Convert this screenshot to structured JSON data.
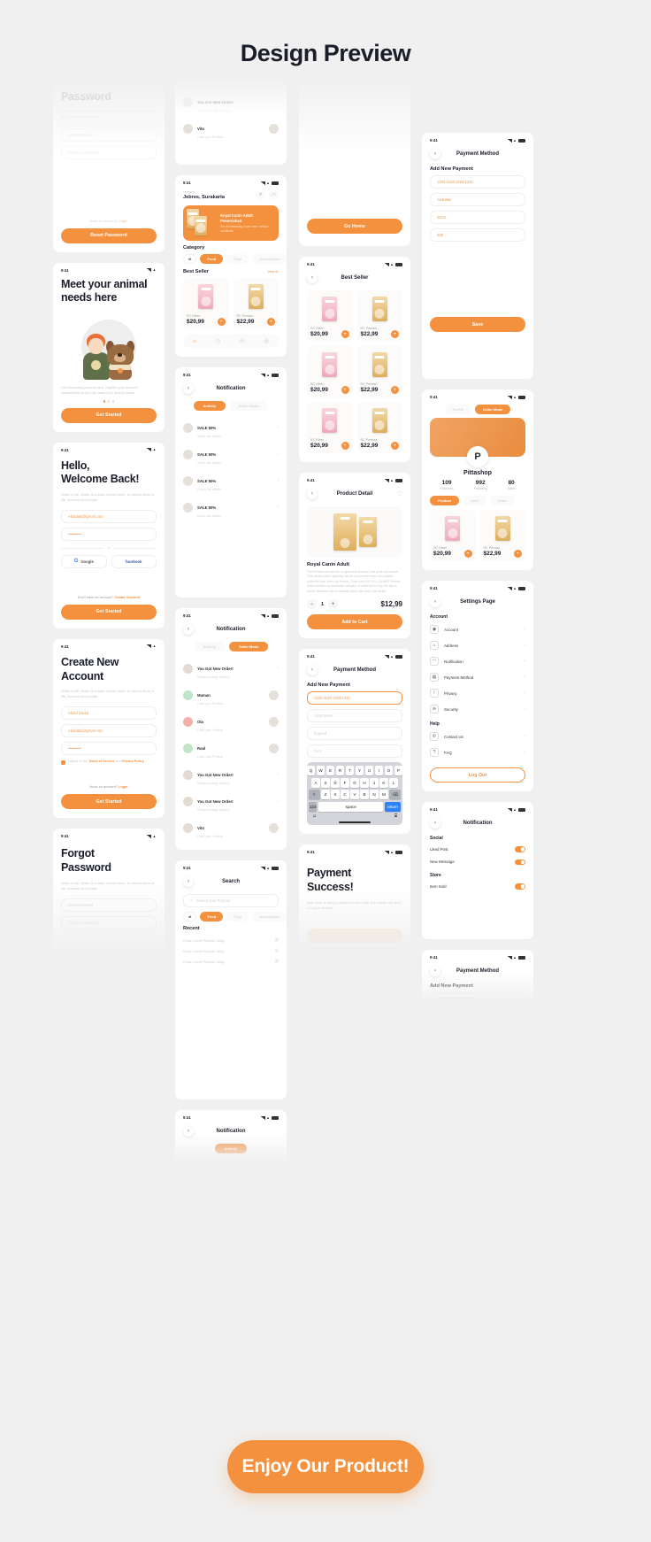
{
  "header": {
    "title": "Design Preview"
  },
  "cta": {
    "label": "Enjoy Our Product!"
  },
  "status": {
    "time": "9:41"
  },
  "common": {
    "lorem": "Water is life, Water is a basic human need. In various lines of life, humans need water.",
    "back_icon": "chevron-left-icon",
    "see_all": "View All"
  },
  "screens": {
    "reset_password": {
      "title": "Password",
      "desc": "Water is life, Water is a basic human need. In various lines of life, humans need water.",
      "fields": [
        {
          "placeholder": "New Password"
        },
        {
          "placeholder": "Confirm Password"
        }
      ],
      "note": "Have an account?",
      "note_link": "Login",
      "button": "Reset Password"
    },
    "onboarding": {
      "title": "Meet your animal needs here",
      "desc": "Get interesting promos here, register your account immediately so you can meet your animal needs.",
      "button": "Get Started"
    },
    "login": {
      "title_line1": "Hello,",
      "title_line2": "Welcome Back!",
      "desc": "Water is life, Water is a basic human need. In various lines of life, humans need water.",
      "email": "Abdulalu@gmail.com",
      "password": "••••••••••",
      "divider": "or",
      "social": [
        {
          "label": "Google",
          "icon": "google-icon"
        },
        {
          "label": "facebook",
          "icon": "facebook-icon"
        }
      ],
      "note": "Don't have an account?",
      "note_link": "Create Account",
      "button": "Get Started"
    },
    "register": {
      "title_line1": "Create New",
      "title_line2": "Account",
      "desc": "Water is life, Water is a basic human need. In various lines of life, humans need water.",
      "name": "Abdul Dudul",
      "email": "Abduldul@gmail.com",
      "password": "••••••••••",
      "agree_prefix": "I Agree to the",
      "agree_terms": "Terms of Service",
      "agree_and": "and",
      "agree_privacy": "Privacy Policy",
      "note": "Have an account?",
      "note_link": "Login",
      "button": "Get Started"
    },
    "forgot_password": {
      "title_line1": "Forgot",
      "title_line2": "Password",
      "desc": "Water is life, Water is a basic human need. In various lines of life, humans need water.",
      "fields": [
        {
          "placeholder": "New Password"
        },
        {
          "placeholder": "Confirm Password"
        }
      ]
    },
    "home": {
      "location_label": "Location",
      "location_value": "Jebres, Surakarta",
      "search_icon": "search-icon",
      "bell_icon": "bell-icon",
      "banner_title": "Royal Canin Adult Pemeriahan",
      "banner_sub": "Get an interesting promo here, without conditions",
      "category_title": "Category",
      "filter_icon": "filter-icon",
      "categories": [
        {
          "label": "Food",
          "active": true
        },
        {
          "label": "Toys",
          "active": false
        },
        {
          "label": "Accessories",
          "active": false
        }
      ],
      "best_seller_title": "Best Seller",
      "see_all": "View All",
      "products": [
        {
          "name": "RC Kitten",
          "price": "$20,99",
          "color": "pink"
        },
        {
          "name": "RC Persian",
          "price": "$22,99",
          "color": "gold"
        }
      ],
      "tabs": [
        {
          "icon": "home-icon",
          "active": true
        },
        {
          "icon": "history-icon",
          "active": false
        },
        {
          "icon": "bag-icon",
          "active": false
        },
        {
          "icon": "user-icon",
          "active": false
        }
      ]
    },
    "notification_activity": {
      "title": "Notification",
      "tabs": [
        {
          "label": "Activity",
          "active": true
        },
        {
          "label": "Seller Mode",
          "active": false
        }
      ],
      "items": [
        {
          "title": "SALE 50%",
          "sub": "Check the details"
        },
        {
          "title": "SALE 50%",
          "sub": "Check the details"
        },
        {
          "title": "SALE 50%",
          "sub": "Check the details"
        },
        {
          "title": "SALE 50%",
          "sub": "Check the details"
        }
      ]
    },
    "notification_seller": {
      "title": "Notification",
      "tabs": [
        {
          "label": "Activity",
          "active": false
        },
        {
          "label": "Seller Mode",
          "active": true
        }
      ],
      "items": [
        {
          "title": "You Got New Order!",
          "sub": "Please arrange delivery",
          "color": "#e3dbd2"
        },
        {
          "title": "Maman",
          "sub": "Liked your Product",
          "color": "#bfe6c8"
        },
        {
          "title": "Ola",
          "sub": "Liked your Product",
          "color": "#f3b0ab"
        },
        {
          "title": "Raul",
          "sub": "Liked your Product",
          "color": "#bfe6c8"
        },
        {
          "title": "You Got New Order!",
          "sub": "Please arrange delivery",
          "color": "#e3dbd2"
        },
        {
          "title": "You Got New Order!",
          "sub": "Please arrange delivery",
          "color": "#e3dbd2"
        },
        {
          "title": "Vito",
          "sub": "Liked your Product",
          "color": "#e6dcd4"
        }
      ]
    },
    "search": {
      "title": "Search",
      "placeholder": "Search your Product",
      "search_icon": "search-icon",
      "filter_icon": "filter-icon",
      "categories": [
        {
          "label": "Food",
          "active": true
        },
        {
          "label": "Toys",
          "active": false
        },
        {
          "label": "Accessories",
          "active": false
        }
      ],
      "recent_title": "Recent",
      "recent": [
        "Royal Canin Persian 500g",
        "Royal Canin Persian 500g",
        "Royal Canin Persian 500g"
      ]
    },
    "go_home": {
      "button": "Go Home"
    },
    "best_seller": {
      "title": "Best Seller",
      "products": [
        {
          "name": "RC Kitten",
          "price": "$20,99",
          "color": "pink"
        },
        {
          "name": "RC Persian",
          "price": "$22,99",
          "color": "gold"
        },
        {
          "name": "RC Kitten",
          "price": "$20,99",
          "color": "pink"
        },
        {
          "name": "RC Persian",
          "price": "$22,99",
          "color": "gold"
        },
        {
          "name": "RC Kitten",
          "price": "$20,99",
          "color": "pink"
        },
        {
          "name": "RC Persian",
          "price": "$22,99",
          "color": "gold"
        }
      ]
    },
    "product_detail": {
      "title": "Product Detail",
      "heart_icon": "heart-icon",
      "product_name": "Royal Canin Adult",
      "description": "The Persian cat has the longest and densest coat of all cat breeds. This means that it typically needs to consume more skin-health nutrients than other cat breeds. That's why ROYAL CANIN® Persian Adult contains an exclusive complex of nutrients to help the skin's barrier defense role to maintain good skin and coat health.",
      "qty": "1",
      "price": "$12,99",
      "button": "Add to Cart"
    },
    "payment_method_form": {
      "title": "Payment Method",
      "section": "Add New Payment",
      "card_number": "1233 4128 1293 1231",
      "fields": [
        {
          "placeholder": "Card Name"
        },
        {
          "placeholder": "Expired"
        },
        {
          "placeholder": "CVV"
        }
      ]
    },
    "keyboard": {
      "row1": [
        "Q",
        "W",
        "E",
        "R",
        "T",
        "Y",
        "U",
        "I",
        "O",
        "P"
      ],
      "row2": [
        "A",
        "S",
        "D",
        "F",
        "G",
        "H",
        "J",
        "K",
        "L"
      ],
      "row3": [
        "Z",
        "X",
        "C",
        "V",
        "B",
        "N",
        "M"
      ],
      "shift": "shift-icon",
      "backspace": "backspace-icon",
      "numbers": "123",
      "space": "space",
      "return": "return",
      "emoji": "emoji-icon",
      "mic": "mic-icon"
    },
    "payment_success": {
      "title_line1": "Payment",
      "title_line2": "Success!",
      "desc": "your order is being prepared by the shop, the courier will send it to your address"
    },
    "payment_method_saved": {
      "title": "Payment Method",
      "section": "Add New Payment",
      "fields": [
        {
          "value": "1233 4128 1293 1231"
        },
        {
          "value": "Abdulalu"
        },
        {
          "value": "28/12"
        },
        {
          "value": "308"
        }
      ],
      "button": "Save"
    },
    "profile": {
      "tabs": [
        {
          "label": "Profile",
          "active": false
        },
        {
          "label": "Seller Mode",
          "active": true
        }
      ],
      "avatar_letter": "P",
      "shop_name": "Pittashop",
      "stats": [
        {
          "value": "109",
          "label": "Followers"
        },
        {
          "value": "992",
          "label": "Following"
        },
        {
          "value": "80",
          "label": "Sales"
        }
      ],
      "chips": [
        {
          "label": "Product",
          "active": true
        },
        {
          "label": "Sold",
          "active": false
        },
        {
          "label": "Sales",
          "active": false
        }
      ],
      "products": [
        {
          "name": "RC Kitten",
          "price": "$20,99",
          "color": "pink"
        },
        {
          "name": "RC Persian",
          "price": "$22,99",
          "color": "gold"
        }
      ]
    },
    "settings": {
      "title": "Settings Page",
      "groups": [
        {
          "name": "Account",
          "items": [
            {
              "label": "Account",
              "icon": "user-icon"
            },
            {
              "label": "Address",
              "icon": "home-icon"
            },
            {
              "label": "Notification",
              "icon": "bell-icon"
            },
            {
              "label": "Payment Method",
              "icon": "card-icon"
            },
            {
              "label": "Privacy",
              "icon": "info-icon"
            },
            {
              "label": "Security",
              "icon": "shield-icon"
            }
          ]
        },
        {
          "name": "Help",
          "items": [
            {
              "label": "Contact Us",
              "icon": "phone-icon"
            },
            {
              "label": "FAQ",
              "icon": "question-icon"
            }
          ]
        }
      ],
      "logout": "Log Out"
    },
    "notification_settings": {
      "title": "Notification",
      "groups": [
        {
          "name": "Social",
          "items": [
            {
              "label": "Liked Post",
              "on": true
            },
            {
              "label": "New Message",
              "on": true
            }
          ]
        },
        {
          "name": "Store",
          "items": [
            {
              "label": "Item Sold",
              "on": true
            }
          ]
        }
      ]
    }
  }
}
